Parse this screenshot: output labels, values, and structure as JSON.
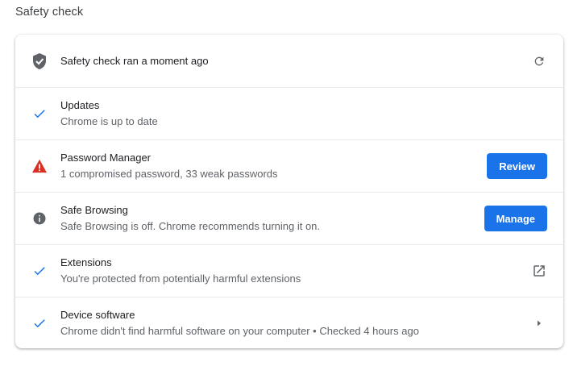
{
  "page": {
    "section_title": "Safety check"
  },
  "header_row": {
    "status": "Safety check ran a moment ago",
    "icon": "shield-check-icon",
    "action_icon": "refresh-icon"
  },
  "items": [
    {
      "title": "Updates",
      "subtitle": "Chrome is up to date",
      "icon": "check-icon"
    },
    {
      "title": "Password Manager",
      "subtitle": "1 compromised password, 33 weak passwords",
      "icon": "warning-icon",
      "button": "Review"
    },
    {
      "title": "Safe Browsing",
      "subtitle": "Safe Browsing is off. Chrome recommends turning it on.",
      "icon": "info-icon",
      "button": "Manage"
    },
    {
      "title": "Extensions",
      "subtitle": "You're protected from potentially harmful extensions",
      "icon": "check-icon",
      "action_icon": "open-in-new-icon"
    },
    {
      "title": "Device software",
      "subtitle": "Chrome didn't find harmful software on your computer • Checked 4 hours ago",
      "icon": "check-icon",
      "action_icon": "arrow-right-icon"
    }
  ],
  "colors": {
    "accent": "#1a73e8",
    "check": "#1a73e8",
    "warning": "#d93025",
    "icon_gray": "#5f6368",
    "divider": "#e8eaed"
  }
}
